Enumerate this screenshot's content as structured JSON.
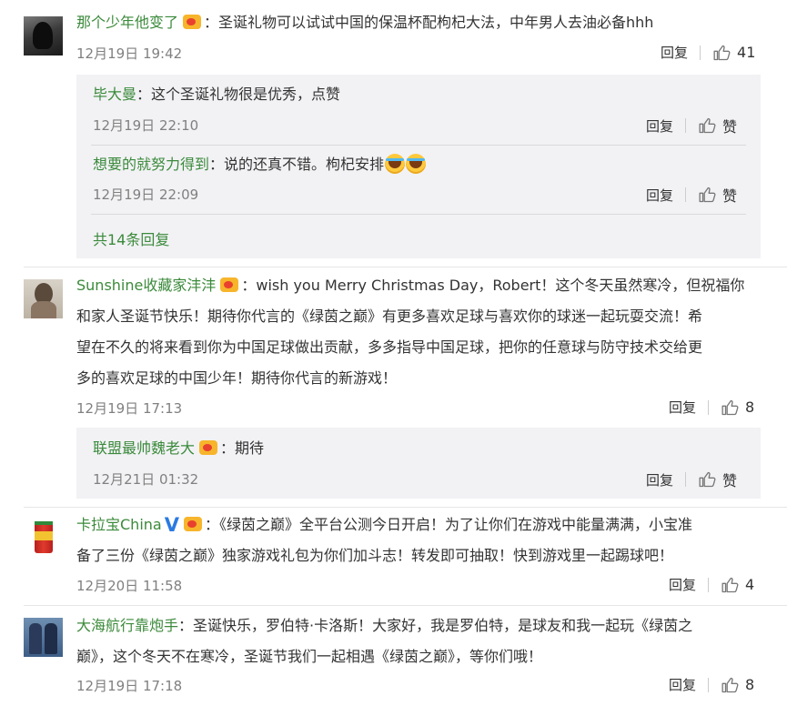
{
  "icons": {
    "like": "thumbs-up-icon",
    "vip": "vip-crown-icon",
    "verified": "verified-v-icon",
    "emoji": "laugh-cry-emoji"
  },
  "labels": {
    "reply": "回复",
    "like": "赞"
  },
  "colors": {
    "username": "#3b8a3b",
    "meta": "#808080",
    "reply_bg": "#f2f2f5",
    "verified": "#2a7ae2"
  },
  "comments": [
    {
      "user": "那个少年他变了",
      "text": "：圣诞礼物可以试试中国的保温杯配枸杞大法，中年男人去油必备hhh",
      "time": "12月19日 19:42",
      "likes": "41",
      "replies": [
        {
          "user": "毕大曼",
          "text": "：这个圣诞礼物很是优秀，点赞",
          "time": "12月19日 22:10"
        },
        {
          "user": "想要的就努力得到",
          "text": "：说的还真不错。枸杞安排",
          "time": "12月19日 22:09"
        }
      ],
      "more_replies": "共14条回复"
    },
    {
      "user": "Sunshine收藏家沣沣",
      "lines": [
        "：wish you Merry Christmas Day，Robert！这个冬天虽然寒冷，但祝福你",
        "和家人圣诞节快乐！期待你代言的《绿茵之巅》有更多喜欢足球与喜欢你的球迷一起玩耍交流！希",
        "望在不久的将来看到你为中国足球做出贡献，多多指导中国足球，把你的任意球与防守技术交给更",
        "多的喜欢足球的中国少年！期待你代言的新游戏！"
      ],
      "time": "12月19日 17:13",
      "likes": "8",
      "replies": [
        {
          "user": "联盟最帅魏老大",
          "text": "：期待",
          "time": "12月21日 01:32"
        }
      ]
    },
    {
      "user": "卡拉宝China",
      "lines": [
        "：《绿茵之巅》全平台公测今日开启！为了让你们在游戏中能量满满，小宝准",
        "备了三份《绿茵之巅》独家游戏礼包为你们加斗志！转发即可抽取！快到游戏里一起踢球吧！"
      ],
      "time": "12月20日 11:58",
      "likes": "4"
    },
    {
      "user": "大海航行靠炮手",
      "lines": [
        "：圣诞快乐，罗伯特·卡洛斯！大家好，我是罗伯特，是球友和我一起玩《绿茵之",
        "巅》，这个冬天不在寒冷，圣诞节我们一起相遇《绿茵之巅》，等你们哦！"
      ],
      "time": "12月19日 17:18",
      "likes": "8"
    }
  ]
}
